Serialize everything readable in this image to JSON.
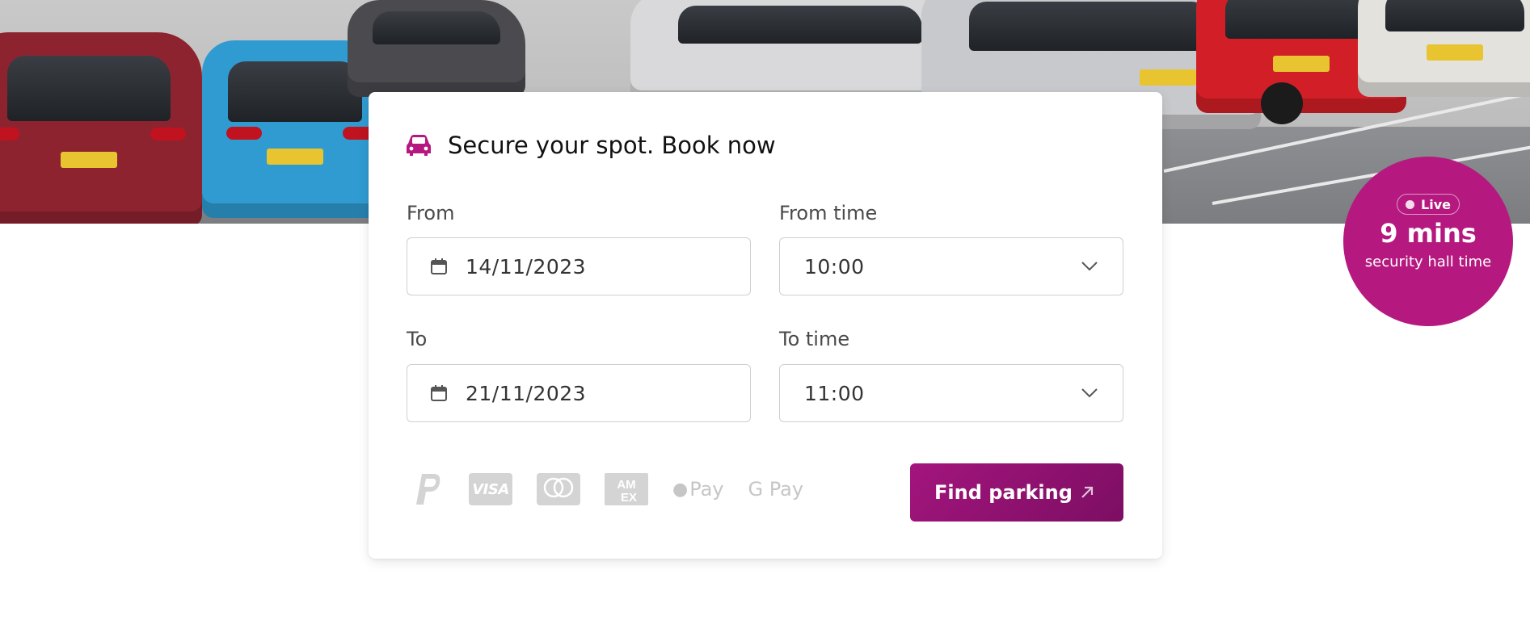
{
  "hero": {
    "image": "parking-lot-photo"
  },
  "booking": {
    "title": "Secure your spot. Book now",
    "from": {
      "label": "From",
      "value": "14/11/2023"
    },
    "from_time": {
      "label": "From time",
      "value": "10:00"
    },
    "to": {
      "label": "To",
      "value": "21/11/2023"
    },
    "to_time": {
      "label": "To time",
      "value": "11:00"
    },
    "payment_methods": [
      "PayPal",
      "Visa",
      "Mastercard",
      "American Express",
      "Apple Pay",
      "Google Pay"
    ],
    "apple_pay_label": "Pay",
    "google_pay_label": "G Pay",
    "find_button": "Find parking"
  },
  "live_status": {
    "pill": "Live",
    "time": "9 mins",
    "caption": "security hall time"
  },
  "colors": {
    "brand": "#b5197f",
    "button": "#8f127a",
    "payment_icon": "#d4d4d4"
  }
}
